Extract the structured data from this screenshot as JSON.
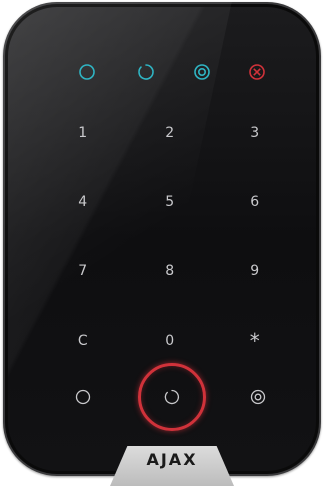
{
  "keypad": {
    "indicators": [
      {
        "icon": "disarmed-circle-icon",
        "color": "#2fb5c4"
      },
      {
        "icon": "armed-partial-icon",
        "color": "#2fb5c4"
      },
      {
        "icon": "night-mode-icon",
        "color": "#2fb5c4"
      },
      {
        "icon": "alarm-cross-icon",
        "color": "#d0323a"
      }
    ],
    "keys": {
      "row1": [
        "1",
        "2",
        "3"
      ],
      "row2": [
        "4",
        "5",
        "6"
      ],
      "row3": [
        "7",
        "8",
        "9"
      ],
      "row4": [
        "C",
        "0",
        "*"
      ]
    },
    "function_keys": [
      "disarm-icon",
      "arm-icon",
      "night-mode-icon"
    ],
    "highlighted_key": "arm",
    "highlight_color": "#d0323a",
    "label_color": "#c9c9cc"
  },
  "brand": {
    "logo_text": "AJAX"
  }
}
